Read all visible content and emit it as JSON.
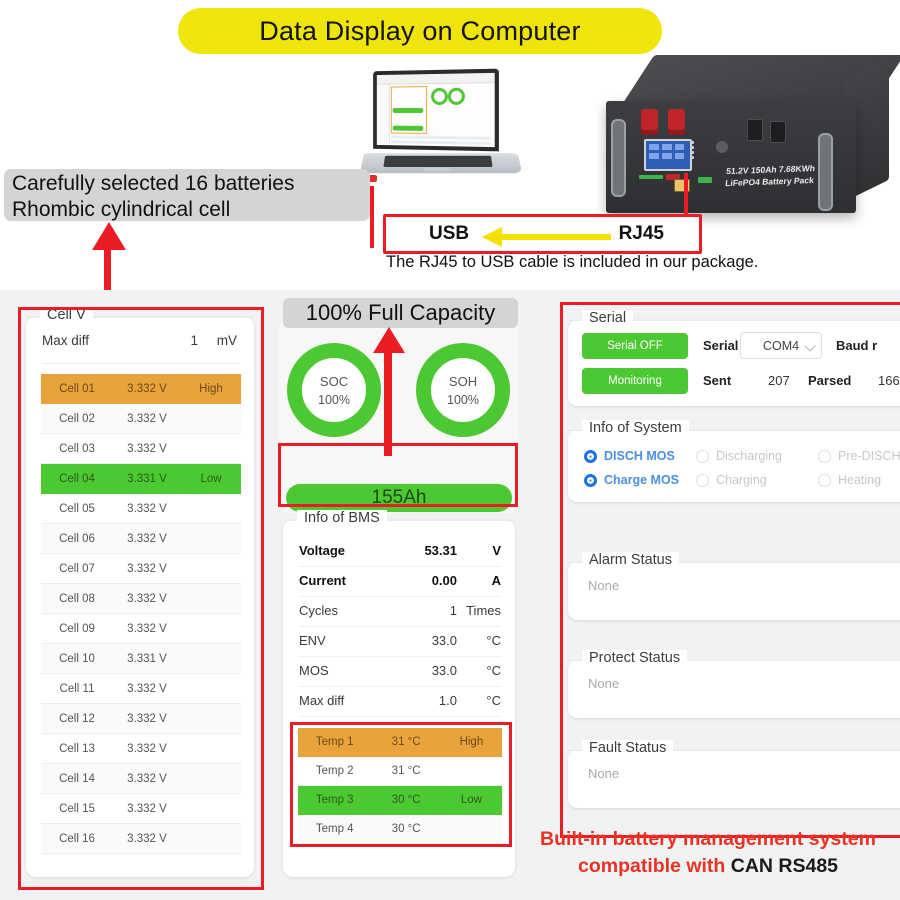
{
  "marketing": {
    "title": "Data Display on Computer",
    "left_callout_line1": "Carefully selected 16 batteries",
    "left_callout_line2": "Rhombic cylindrical cell",
    "full_capacity_badge": "100% Full Capacity",
    "usb_label": "USB",
    "rj45_label": "RJ45",
    "cable_note": "The RJ45 to USB cable is included in our package.",
    "bms_slogan_line1": "Built-in battery management system",
    "bms_slogan_line2_red": "compatible with ",
    "bms_slogan_line2_black": "CAN RS485",
    "accent_red": "#ec1c24",
    "accent_yellow": "#efe50d",
    "accent_green": "#4cc832",
    "accent_orange": "#e8a33d"
  },
  "product": {
    "label_line1": "51.2V 150Ah 7.68KWh",
    "label_line2": "LiFePO4 Battery Pack"
  },
  "app": {
    "cell_v": {
      "title": "Cell V",
      "max_diff_label": "Max diff",
      "max_diff_value": "1",
      "max_diff_unit": "mV",
      "rows": [
        {
          "name": "Cell 01",
          "value": "3.332 V",
          "tag": "High",
          "state": "high"
        },
        {
          "name": "Cell 02",
          "value": "3.332 V",
          "tag": "",
          "state": "alt"
        },
        {
          "name": "Cell 03",
          "value": "3.332 V",
          "tag": "",
          "state": ""
        },
        {
          "name": "Cell 04",
          "value": "3.331 V",
          "tag": "Low",
          "state": "low"
        },
        {
          "name": "Cell 05",
          "value": "3.332 V",
          "tag": "",
          "state": ""
        },
        {
          "name": "Cell 06",
          "value": "3.332 V",
          "tag": "",
          "state": "alt"
        },
        {
          "name": "Cell 07",
          "value": "3.332 V",
          "tag": "",
          "state": ""
        },
        {
          "name": "Cell 08",
          "value": "3.332 V",
          "tag": "",
          "state": "alt"
        },
        {
          "name": "Cell 09",
          "value": "3.332 V",
          "tag": "",
          "state": ""
        },
        {
          "name": "Cell 10",
          "value": "3.331 V",
          "tag": "",
          "state": "alt"
        },
        {
          "name": "Cell 11",
          "value": "3.332 V",
          "tag": "",
          "state": ""
        },
        {
          "name": "Cell 12",
          "value": "3.332 V",
          "tag": "",
          "state": "alt"
        },
        {
          "name": "Cell 13",
          "value": "3.332 V",
          "tag": "",
          "state": ""
        },
        {
          "name": "Cell 14",
          "value": "3.332 V",
          "tag": "",
          "state": "alt"
        },
        {
          "name": "Cell 15",
          "value": "3.332 V",
          "tag": "",
          "state": ""
        },
        {
          "name": "Cell 16",
          "value": "3.332 V",
          "tag": "",
          "state": "alt"
        }
      ]
    },
    "gauges": {
      "soc_label": "SOC",
      "soc_value": "100%",
      "soh_label": "SOH",
      "soh_value": "100%",
      "capacity": "155Ah"
    },
    "bms": {
      "title": "Info of BMS",
      "rows": [
        {
          "key": "Voltage",
          "value": "53.31",
          "unit": "V",
          "bold": true
        },
        {
          "key": "Current",
          "value": "0.00",
          "unit": "A",
          "bold": true
        },
        {
          "key": "Cycles",
          "value": "1",
          "unit": "Times",
          "bold": false
        },
        {
          "key": "ENV",
          "value": "33.0",
          "unit": "°C",
          "bold": false
        },
        {
          "key": "MOS",
          "value": "33.0",
          "unit": "°C",
          "bold": false
        },
        {
          "key": "Max diff",
          "value": "1.0",
          "unit": "°C",
          "bold": false
        }
      ],
      "temps": [
        {
          "name": "Temp 1",
          "value": "31 °C",
          "tag": "High",
          "state": "high"
        },
        {
          "name": "Temp 2",
          "value": "31 °C",
          "tag": "",
          "state": ""
        },
        {
          "name": "Temp 3",
          "value": "30 °C",
          "tag": "Low",
          "state": "low"
        },
        {
          "name": "Temp 4",
          "value": "30 °C",
          "tag": "",
          "state": "alt"
        }
      ]
    },
    "serial": {
      "title": "Serial",
      "btn_serial": "Serial OFF",
      "btn_monitoring": "Monitoring",
      "label_serial": "Serial",
      "port_value": "COM4",
      "label_baud": "Baud r",
      "label_sent": "Sent",
      "sent_value": "207",
      "label_parsed": "Parsed",
      "parsed_value": "166"
    },
    "system": {
      "title": "Info of System",
      "items": [
        {
          "label": "DISCH MOS",
          "on": true
        },
        {
          "label": "Discharging",
          "on": false
        },
        {
          "label": "Pre-DISCH",
          "on": false
        },
        {
          "label": "Charge MOS",
          "on": true
        },
        {
          "label": "Charging",
          "on": false
        },
        {
          "label": "Heating",
          "on": false
        }
      ]
    },
    "status": {
      "alarm_title": "Alarm Status",
      "alarm_value": "None",
      "protect_title": "Protect Status",
      "protect_value": "None",
      "fault_title": "Fault Status",
      "fault_value": "None"
    }
  }
}
